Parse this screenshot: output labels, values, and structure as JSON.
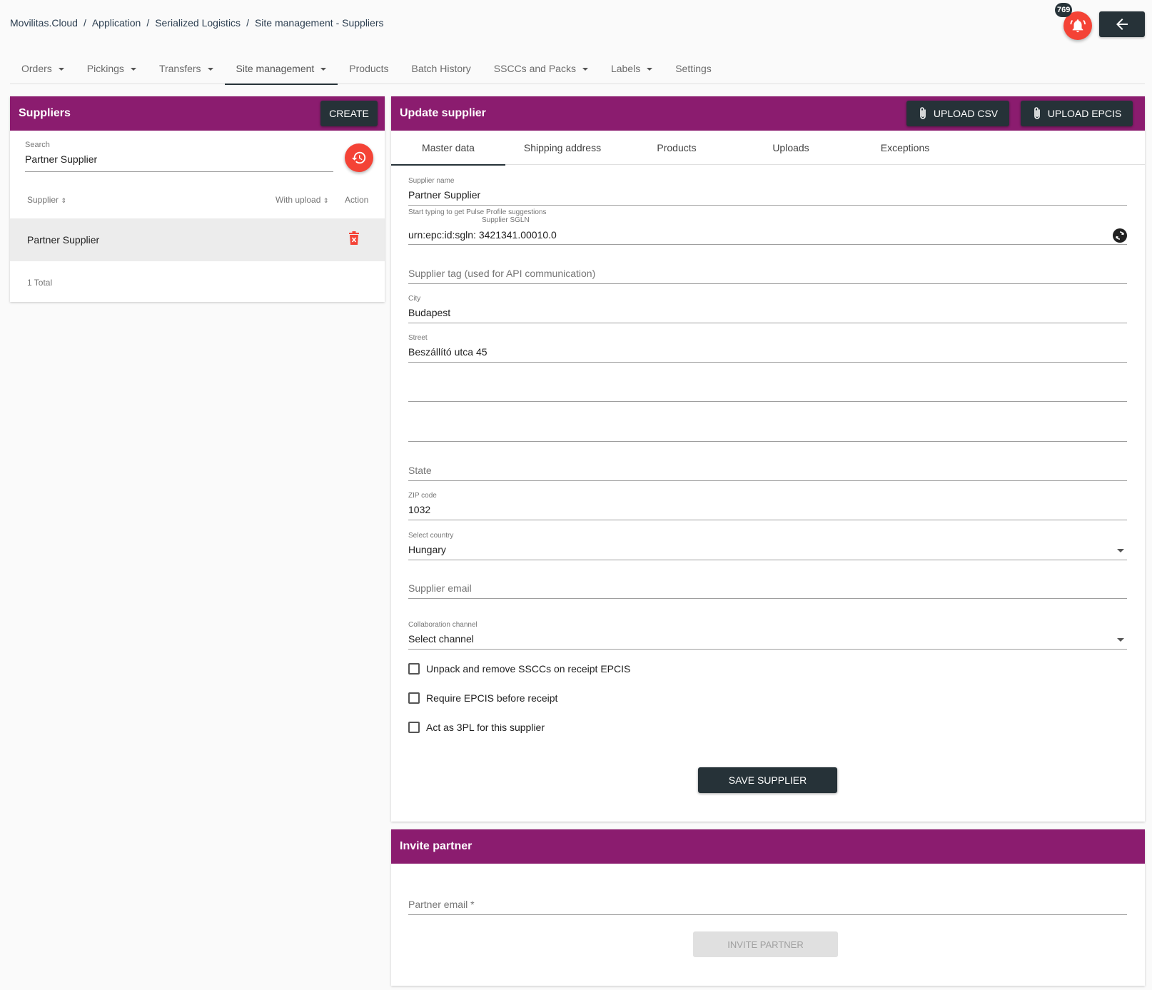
{
  "breadcrumb": {
    "items": [
      "Movilitas.Cloud",
      "Application",
      "Serialized Logistics",
      "Site management - Suppliers"
    ],
    "separator": "/"
  },
  "header": {
    "notification_count": "769",
    "bell_icon": "bell-icon",
    "back_icon": "arrow-left-icon"
  },
  "nav": {
    "tabs": [
      {
        "label": "Orders",
        "dropdown": true
      },
      {
        "label": "Pickings",
        "dropdown": true
      },
      {
        "label": "Transfers",
        "dropdown": true
      },
      {
        "label": "Site management",
        "dropdown": true,
        "active": true
      },
      {
        "label": "Products",
        "dropdown": false
      },
      {
        "label": "Batch History",
        "dropdown": false
      },
      {
        "label": "SSCCs and Packs",
        "dropdown": true
      },
      {
        "label": "Labels",
        "dropdown": true
      },
      {
        "label": "Settings",
        "dropdown": false
      }
    ]
  },
  "suppliers_panel": {
    "title": "Suppliers",
    "create_label": "CREATE",
    "search_label": "Search",
    "search_value": "Partner Supplier",
    "columns": {
      "supplier": "Supplier",
      "with_upload": "With upload",
      "action": "Action"
    },
    "rows": [
      {
        "name": "Partner Supplier"
      }
    ],
    "total": "1 Total"
  },
  "update_panel": {
    "title": "Update supplier",
    "upload_csv_label": "UPLOAD CSV",
    "upload_epcis_label": "UPLOAD EPCIS",
    "tabs": [
      "Master data",
      "Shipping address",
      "Products",
      "Uploads",
      "Exceptions"
    ],
    "active_tab": "Master data",
    "fields": {
      "supplier_name_label": "Supplier name",
      "supplier_name_value": "Partner Supplier",
      "sgln_hint": "Start typing to get Pulse Profile suggestions",
      "sgln_label": "Supplier SGLN",
      "sgln_value": "urn:epc:id:sgln: 3421341.00010.0",
      "tag_placeholder": "Supplier tag (used for API communication)",
      "city_label": "City",
      "city_value": "Budapest",
      "street_label": "Street",
      "street_value": "Beszállító utca 45",
      "state_placeholder": "State",
      "zip_label": "ZIP code",
      "zip_value": "1032",
      "country_label": "Select country",
      "country_value": "Hungary",
      "email_placeholder": "Supplier email",
      "channel_label": "Collaboration channel",
      "channel_value": "Select channel"
    },
    "checkboxes": [
      {
        "label": "Unpack and remove SSCCs on receipt EPCIS",
        "checked": false
      },
      {
        "label": "Require EPCIS before receipt",
        "checked": false
      },
      {
        "label": "Act as 3PL for this supplier",
        "checked": false
      }
    ],
    "save_label": "SAVE SUPPLIER"
  },
  "invite_panel": {
    "title": "Invite partner",
    "email_placeholder": "Partner email *",
    "invite_label": "INVITE PARTNER"
  },
  "colors": {
    "header_purple": "#8b1c6f",
    "dark_button": "#263238",
    "accent_red": "#f44336"
  }
}
